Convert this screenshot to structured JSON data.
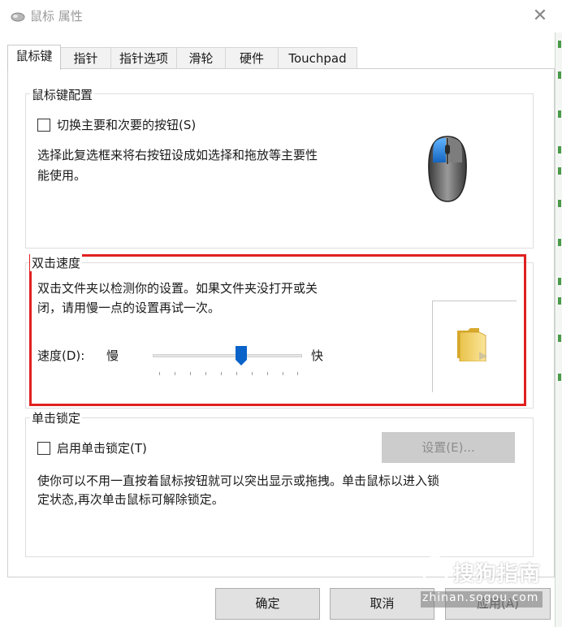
{
  "window": {
    "title": "鼠标 属性",
    "close_icon": "close-icon"
  },
  "tabs": [
    {
      "label": "鼠标键",
      "active": true
    },
    {
      "label": "指针",
      "active": false
    },
    {
      "label": "指针选项",
      "active": false
    },
    {
      "label": "滑轮",
      "active": false
    },
    {
      "label": "硬件",
      "active": false
    },
    {
      "label": "Touchpad",
      "active": false
    }
  ],
  "button_config": {
    "title": "鼠标键配置",
    "swap_checkbox_label": "切换主要和次要的按钮(S)",
    "swap_checked": false,
    "description_line1": "选择此复选框来将右按钮设成如选择和拖放等主要性",
    "description_line2": "能使用。",
    "mouse_icon": "mouse-icon"
  },
  "double_click": {
    "title": "双击速度",
    "description_line1": "双击文件夹以检测你的设置。如果文件夹没打开或关",
    "description_line2": "闭，请用慢一点的设置再试一次。",
    "speed_label": "速度(D):",
    "slow_label": "慢",
    "fast_label": "快",
    "speed_value": 0.59,
    "folder_icon": "folder-icon"
  },
  "click_lock": {
    "title": "单击锁定",
    "enable_checkbox_label": "启用单击锁定(T)",
    "enable_checked": false,
    "settings_button": "设置(E)...",
    "description_line1": "使你可以不用一直按着鼠标按钮就可以突出显示或拖拽。单击鼠标以进入锁",
    "description_line2": "定状态,再次单击鼠标可解除锁定。"
  },
  "footer": {
    "ok": "确定",
    "cancel": "取消",
    "apply": "应用(A)"
  },
  "watermark": {
    "text": "搜狗指南",
    "url": "zhinan.sogou.com"
  },
  "colors": {
    "highlight": "#e02020",
    "mouse_accent": "#1e88e5"
  }
}
